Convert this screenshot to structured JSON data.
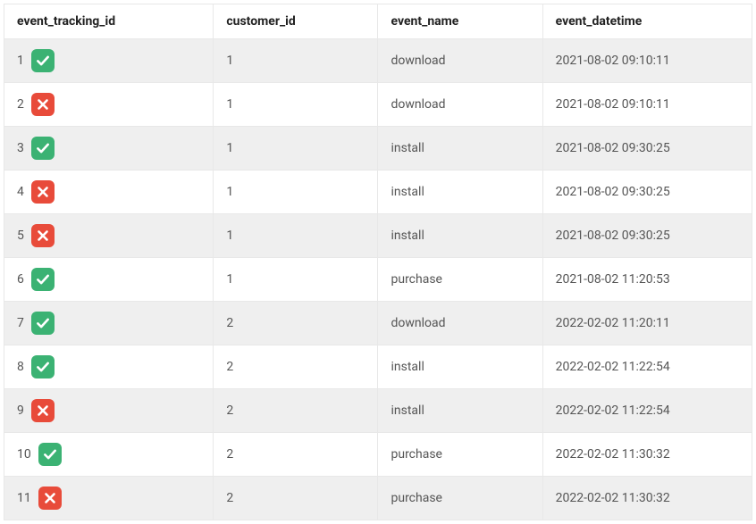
{
  "columns": [
    "event_tracking_id",
    "customer_id",
    "event_name",
    "event_datetime"
  ],
  "rows": [
    {
      "event_tracking_id": 1,
      "status": "check",
      "customer_id": 1,
      "event_name": "download",
      "event_datetime": "2021-08-02 09:10:11"
    },
    {
      "event_tracking_id": 2,
      "status": "cross",
      "customer_id": 1,
      "event_name": "download",
      "event_datetime": "2021-08-02 09:10:11"
    },
    {
      "event_tracking_id": 3,
      "status": "check",
      "customer_id": 1,
      "event_name": "install",
      "event_datetime": "2021-08-02 09:30:25"
    },
    {
      "event_tracking_id": 4,
      "status": "cross",
      "customer_id": 1,
      "event_name": "install",
      "event_datetime": "2021-08-02 09:30:25"
    },
    {
      "event_tracking_id": 5,
      "status": "cross",
      "customer_id": 1,
      "event_name": "install",
      "event_datetime": "2021-08-02 09:30:25"
    },
    {
      "event_tracking_id": 6,
      "status": "check",
      "customer_id": 1,
      "event_name": "purchase",
      "event_datetime": "2021-08-02 11:20:53"
    },
    {
      "event_tracking_id": 7,
      "status": "check",
      "customer_id": 2,
      "event_name": "download",
      "event_datetime": "2022-02-02 11:20:11"
    },
    {
      "event_tracking_id": 8,
      "status": "check",
      "customer_id": 2,
      "event_name": "install",
      "event_datetime": "2022-02-02 11:22:54"
    },
    {
      "event_tracking_id": 9,
      "status": "cross",
      "customer_id": 2,
      "event_name": "install",
      "event_datetime": "2022-02-02 11:22:54"
    },
    {
      "event_tracking_id": 10,
      "status": "check",
      "customer_id": 2,
      "event_name": "purchase",
      "event_datetime": "2022-02-02 11:30:32"
    },
    {
      "event_tracking_id": 11,
      "status": "cross",
      "customer_id": 2,
      "event_name": "purchase",
      "event_datetime": "2022-02-02 11:30:32"
    }
  ]
}
